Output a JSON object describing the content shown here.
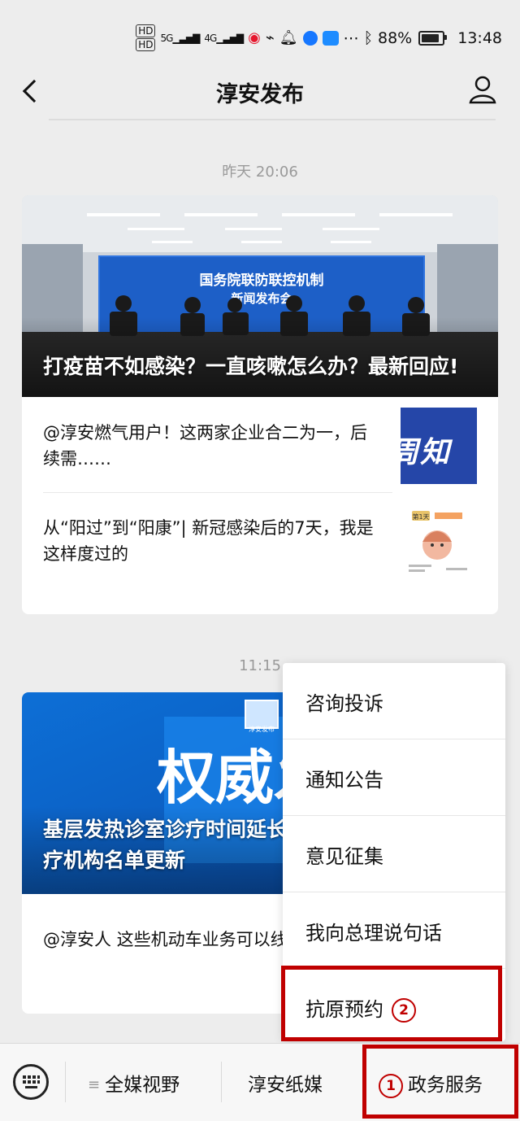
{
  "status_bar": {
    "hd1": "HD",
    "hd2": "HD",
    "sig1": "5G",
    "sig2": "4G",
    "battery": "88%",
    "time": "13:48"
  },
  "header": {
    "title": "淳安发布"
  },
  "feed": {
    "timestamp1": "昨天 20:06",
    "card1": {
      "hero_title": "打疫苗不如感染？一直咳嗽怎么办？最新回应!",
      "banner_line1": "国务院联防联控机制",
      "banner_line2": "新闻发布会",
      "items": [
        {
          "title": "@淳安燃气用户！这两家企业合二为一，后续需……",
          "thumb_text": "周知"
        },
        {
          "title": "从“阳过”到“阳康”| 新冠感染后的7天，我是这样度过的",
          "thumb_text": "第1天"
        }
      ]
    },
    "timestamp2": "11:15",
    "card2": {
      "hero_title": "基层发热诊室诊疗时间延长，发热门诊(诊室)医疗机构名单更新",
      "hero_banner": "权威发布",
      "hero_small": "淳安发布",
      "items": [
        {
          "title": "@淳安人 这些机动车业务可以线上办理!"
        }
      ]
    }
  },
  "popup_menu": {
    "items": [
      "咨询投诉",
      "通知公告",
      "意见征集",
      "我向总理说句话",
      "抗原预约"
    ],
    "badge": "2"
  },
  "bottom_bar": {
    "tabs": [
      "全媒视野",
      "淳安纸媒",
      "政务服务"
    ],
    "badge": "1"
  },
  "colors": {
    "highlight": "#c00000",
    "background": "#ededed"
  }
}
